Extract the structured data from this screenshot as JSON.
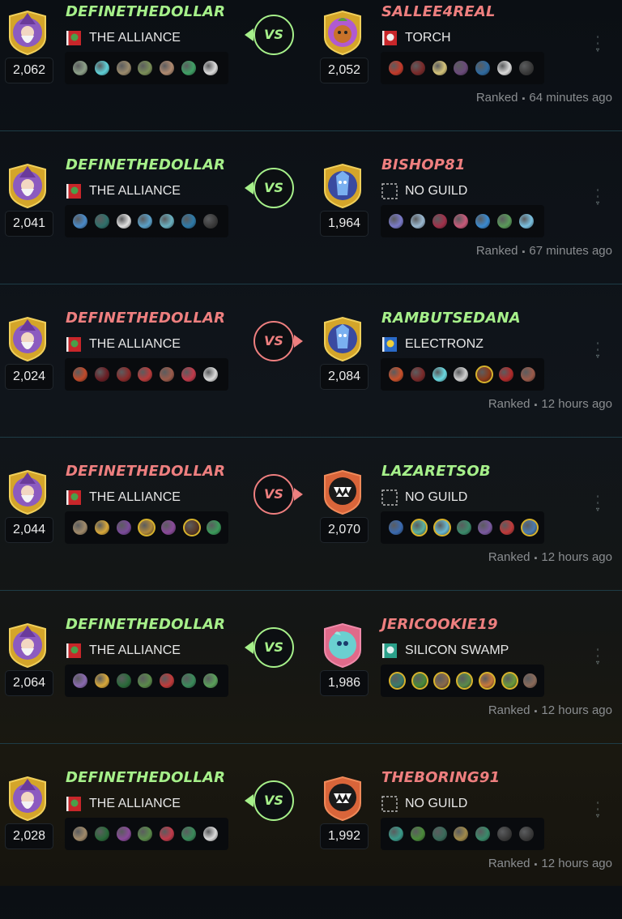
{
  "battles": [
    {
      "left": {
        "name": "DEFINETHEDOLLAR",
        "name_color": "#a6f08a",
        "rating": "2,062",
        "guild": "THE ALLIANCE",
        "guild_icon": "alliance-banner-icon",
        "avatar": "wizard-avatar",
        "cards": [
          "#8da089",
          "#5fd1d8",
          "#9a8a6c",
          "#7a8e58",
          "#b08a70",
          "#3fa065",
          "#dcdcdc"
        ]
      },
      "right": {
        "name": "SALLEE4REAL",
        "name_color": "#ee7f7f",
        "rating": "2,052",
        "guild": "TORCH",
        "guild_icon": "torch-banner-icon",
        "avatar": "goblin-avatar",
        "cards": [
          "#c23a2a",
          "#7a2a2a",
          "#d4c37a",
          "#6a4a7a",
          "#2e6aa0",
          "#dadada",
          "#3a3a3a"
        ]
      },
      "vs_color": "#a6f08a",
      "vs_dir": "left",
      "vs": "VS",
      "status": "Ranked",
      "time": "64 minutes ago"
    },
    {
      "left": {
        "name": "DEFINETHEDOLLAR",
        "name_color": "#a6f08a",
        "rating": "2,041",
        "guild": "THE ALLIANCE",
        "guild_icon": "alliance-banner-icon",
        "avatar": "wizard-avatar",
        "cards": [
          "#4a8ac8",
          "#2f6f6a",
          "#e0e0e0",
          "#5aa0c8",
          "#6ab0c0",
          "#2e7aa8",
          "#3a3a3a"
        ]
      },
      "right": {
        "name": "BISHOP81",
        "name_color": "#ee7f7f",
        "rating": "1,964",
        "guild": "NO GUILD",
        "guild_icon": "no-guild-icon",
        "avatar": "crystal-avatar",
        "cards": [
          "#7a7ac8",
          "#9ab8d0",
          "#a0304a",
          "#c85a7a",
          "#3a8ad0",
          "#5a9a5a",
          "#7ac0e0"
        ]
      },
      "vs_color": "#a6f08a",
      "vs_dir": "left",
      "vs": "VS",
      "status": "Ranked",
      "time": "67 minutes ago"
    },
    {
      "left": {
        "name": "DEFINETHEDOLLAR",
        "name_color": "#ee7f7f",
        "rating": "2,024",
        "guild": "THE ALLIANCE",
        "guild_icon": "alliance-banner-icon",
        "avatar": "wizard-avatar",
        "cards": [
          "#c04a2a",
          "#6a1e24",
          "#8a2a2a",
          "#b83a3a",
          "#9a5a4a",
          "#c03a4a",
          "#dadada"
        ]
      },
      "right": {
        "name": "RAMBUTSEDANA",
        "name_color": "#a6f08a",
        "rating": "2,084",
        "guild": "ELECTRONZ",
        "guild_icon": "electronz-banner-icon",
        "avatar": "crystal-avatar",
        "cards": [
          "#c8502a",
          "#7a2a2a",
          "#6ad8e0",
          "#d0d0d0",
          "#8a3a1a",
          "#b02a2a",
          "#9a5a4a"
        ],
        "gold": [
          4
        ]
      },
      "vs_color": "#ee7f7f",
      "vs_dir": "right",
      "vs": "VS",
      "status": "Ranked",
      "time": "12 hours ago"
    },
    {
      "left": {
        "name": "DEFINETHEDOLLAR",
        "name_color": "#ee7f7f",
        "rating": "2,044",
        "guild": "THE ALLIANCE",
        "guild_icon": "alliance-banner-icon",
        "avatar": "wizard-avatar",
        "cards": [
          "#a08a6a",
          "#d8a83a",
          "#7a4a9a",
          "#b0883a",
          "#8a4a9a",
          "#5a3a2a",
          "#3a9a5a"
        ],
        "gold": [
          3,
          5
        ]
      },
      "right": {
        "name": "LAZARETSOB",
        "name_color": "#a6f08a",
        "rating": "2,070",
        "guild": "NO GUILD",
        "guild_icon": "no-guild-icon",
        "avatar": "monster-avatar",
        "cards": [
          "#3a6ab0",
          "#5ab0a0",
          "#6ab8d0",
          "#3a8a6a",
          "#7a5aa0",
          "#c03a3a",
          "#4a7ab0"
        ],
        "gold": [
          1,
          2,
          6
        ]
      },
      "vs_color": "#ee7f7f",
      "vs_dir": "right",
      "vs": "VS",
      "status": "Ranked",
      "time": "12 hours ago"
    },
    {
      "left": {
        "name": "DEFINETHEDOLLAR",
        "name_color": "#a6f08a",
        "rating": "2,064",
        "guild": "THE ALLIANCE",
        "guild_icon": "alliance-banner-icon",
        "avatar": "wizard-avatar",
        "cards": [
          "#8a6ab0",
          "#d8a83a",
          "#2a6a3a",
          "#5a8a4a",
          "#c03a3a",
          "#3a8a5a",
          "#5aa05a"
        ]
      },
      "right": {
        "name": "JERICOOKIE19",
        "name_color": "#ee7f7f",
        "rating": "1,986",
        "guild": "SILICON SWAMP",
        "guild_icon": "silicon-swamp-banner-icon",
        "avatar": "spirit-avatar",
        "cards": [
          "#3a7a6a",
          "#4a8a3a",
          "#8a6a4a",
          "#5a8a4a",
          "#c8783a",
          "#6a9a3a",
          "#8a6a5a"
        ],
        "gold": [
          0,
          1,
          2,
          3,
          4,
          5
        ]
      },
      "vs_color": "#a6f08a",
      "vs_dir": "left",
      "vs": "VS",
      "status": "Ranked",
      "time": "12 hours ago"
    },
    {
      "left": {
        "name": "DEFINETHEDOLLAR",
        "name_color": "#a6f08a",
        "rating": "2,028",
        "guild": "THE ALLIANCE",
        "guild_icon": "alliance-banner-icon",
        "avatar": "wizard-avatar",
        "cards": [
          "#a08a6a",
          "#2a6a3a",
          "#8a4a9a",
          "#5a8a4a",
          "#c03a4a",
          "#3a8a5a",
          "#dadada"
        ]
      },
      "right": {
        "name": "THEBORING91",
        "name_color": "#ee7f7f",
        "rating": "1,992",
        "guild": "NO GUILD",
        "guild_icon": "no-guild-icon",
        "avatar": "monster-avatar",
        "cards": [
          "#3a9a8a",
          "#4a8a3a",
          "#3a6a5a",
          "#a08a4a",
          "#3a8a6a",
          "#3a3a3a",
          "#3a3a3a"
        ]
      },
      "vs_color": "#a6f08a",
      "vs_dir": "left",
      "vs": "VS",
      "status": "Ranked",
      "time": "12 hours ago"
    }
  ],
  "separator": "▪",
  "colors": {
    "win": "#a6f08a",
    "loss": "#ee7f7f",
    "divider": "#1e3c46"
  }
}
